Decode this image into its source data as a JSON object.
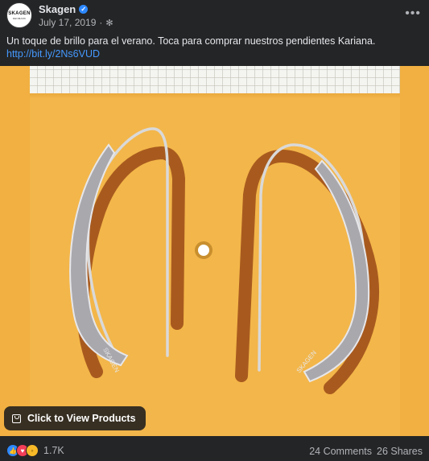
{
  "post": {
    "page_name": "Skagen",
    "avatar_text": "SKAGEN",
    "avatar_subtext": "DENMARK",
    "date": "July 17, 2019",
    "caption": "Un toque de brillo para el verano. Toca para comprar nuestros pendientes Kariana.",
    "link": "http://bit.ly/2Ns6VUD",
    "cta_label": "Click to View Products",
    "engraving": "SKAGEN"
  },
  "icons": {
    "verified": "verified-badge-icon",
    "audience": "gear-icon",
    "more": "more-options-icon",
    "cta": "shopping-bag-icon"
  },
  "colors": {
    "background": "#242526",
    "link": "#4599ff",
    "photo_background": "#f3b64a",
    "like": "#2d88ff",
    "love": "#f33e58",
    "wow": "#f7b928"
  },
  "footer": {
    "reaction_count": "1.7K",
    "comments": "24 Comments",
    "shares": "26 Shares"
  }
}
